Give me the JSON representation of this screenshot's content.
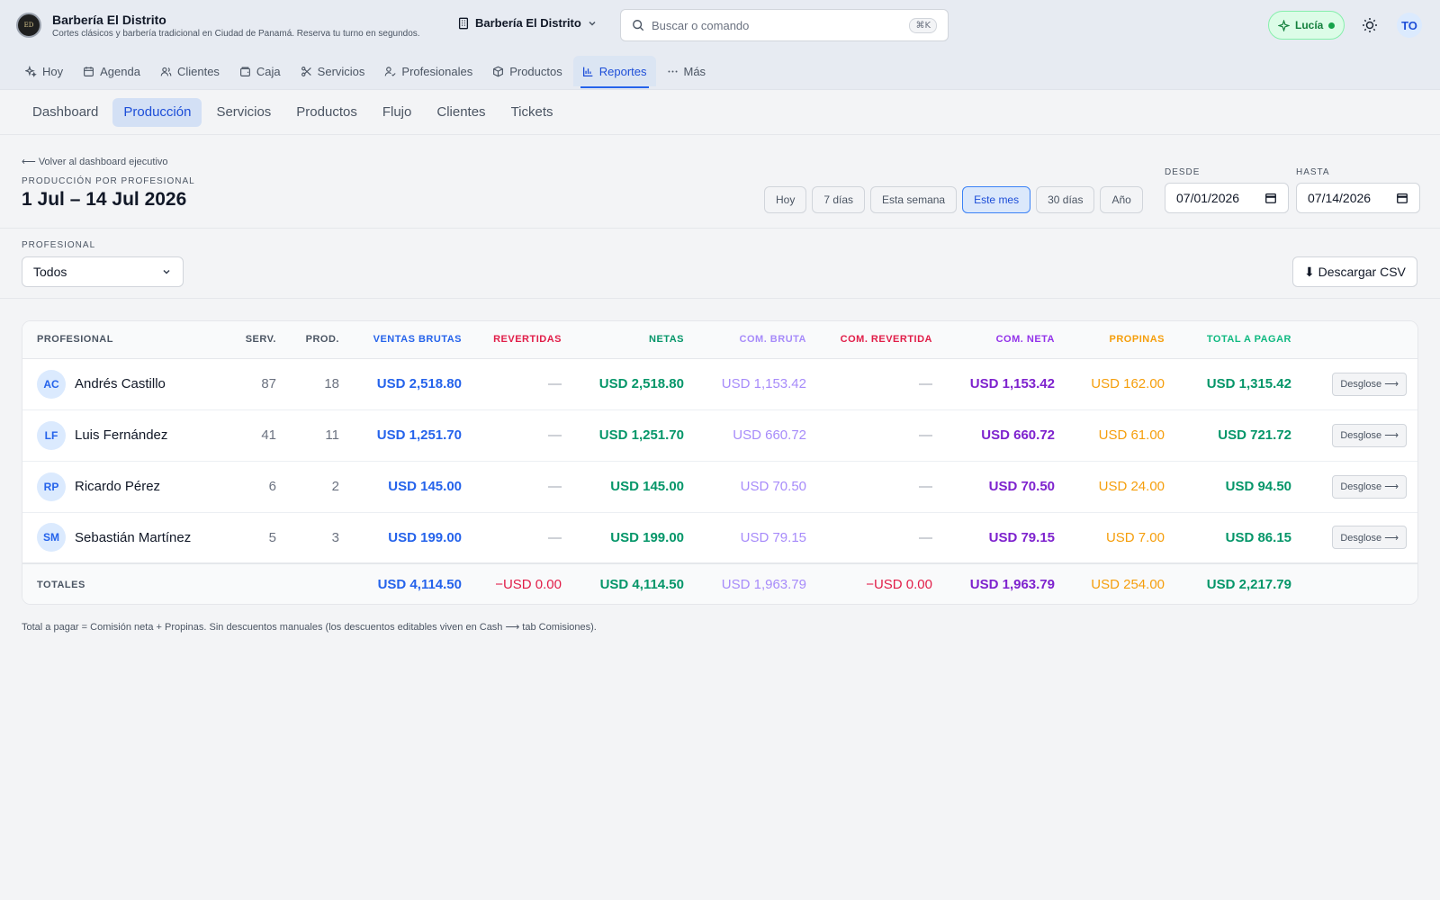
{
  "brand": {
    "name": "Barbería El Distrito",
    "subtitle": "Cortes clásicos y barbería tradicional en Ciudad de Panamá. Reserva tu turno en segundos.",
    "logo_text": "EL DISTRITO"
  },
  "branch": {
    "label": "Barbería El Distrito"
  },
  "search": {
    "placeholder": "Buscar o comando",
    "shortcut": "⌘K"
  },
  "assistant": {
    "label": "Lucía",
    "status_color": "#16a34a"
  },
  "user": {
    "initials": "TO"
  },
  "nav": {
    "items": [
      {
        "label": "Hoy",
        "icon": "sparkle-icon"
      },
      {
        "label": "Agenda",
        "icon": "calendar-icon"
      },
      {
        "label": "Clientes",
        "icon": "users-icon"
      },
      {
        "label": "Caja",
        "icon": "wallet-icon"
      },
      {
        "label": "Servicios",
        "icon": "scissors-icon"
      },
      {
        "label": "Profesionales",
        "icon": "user-check-icon"
      },
      {
        "label": "Productos",
        "icon": "box-icon"
      },
      {
        "label": "Reportes",
        "icon": "bar-chart-icon"
      },
      {
        "label": "Más",
        "icon": "more-icon"
      }
    ],
    "active": "Reportes"
  },
  "subtabs": {
    "items": [
      "Dashboard",
      "Producción",
      "Servicios",
      "Productos",
      "Flujo",
      "Clientes",
      "Tickets"
    ],
    "active": "Producción"
  },
  "report": {
    "back": "⟵ Volver al dashboard ejecutivo",
    "kicker": "PRODUCCIÓN POR PROFESIONAL",
    "title": "1 Jul – 14 Jul 2026",
    "ranges": [
      "Hoy",
      "7 días",
      "Esta semana",
      "Este mes",
      "30 días",
      "Año"
    ],
    "active_range": "Este mes",
    "from_label": "DESDE",
    "from_value": "07/01/2026",
    "to_label": "HASTA",
    "to_value": "07/14/2026"
  },
  "filter": {
    "label": "PROFESIONAL",
    "value": "Todos",
    "csv_label": "⬇ Descargar CSV"
  },
  "table": {
    "headers": {
      "profesional": "PROFESIONAL",
      "serv": "SERV.",
      "prod": "PROD.",
      "ventas": "VENTAS BRUTAS",
      "revertidas": "REVERTIDAS",
      "netas": "NETAS",
      "com_bruta": "COM. BRUTA",
      "com_revertida": "COM. REVERTIDA",
      "com_neta": "COM. NETA",
      "propinas": "PROPINAS",
      "total": "TOTAL A PAGAR"
    },
    "rows": [
      {
        "initials": "AC",
        "name": "Andrés Castillo",
        "serv": "87",
        "prod": "18",
        "ventas": "USD 2,518.80",
        "revertidas": "—",
        "netas": "USD 2,518.80",
        "com_bruta": "USD 1,153.42",
        "com_revertida": "—",
        "com_neta": "USD 1,153.42",
        "propinas": "USD 162.00",
        "total": "USD 1,315.42",
        "action": "Desglose ⟶"
      },
      {
        "initials": "LF",
        "name": "Luis Fernández",
        "serv": "41",
        "prod": "11",
        "ventas": "USD 1,251.70",
        "revertidas": "—",
        "netas": "USD 1,251.70",
        "com_bruta": "USD 660.72",
        "com_revertida": "—",
        "com_neta": "USD 660.72",
        "propinas": "USD 61.00",
        "total": "USD 721.72",
        "action": "Desglose ⟶"
      },
      {
        "initials": "RP",
        "name": "Ricardo Pérez",
        "serv": "6",
        "prod": "2",
        "ventas": "USD 145.00",
        "revertidas": "—",
        "netas": "USD 145.00",
        "com_bruta": "USD 70.50",
        "com_revertida": "—",
        "com_neta": "USD 70.50",
        "propinas": "USD 24.00",
        "total": "USD 94.50",
        "action": "Desglose ⟶"
      },
      {
        "initials": "SM",
        "name": "Sebastián Martínez",
        "serv": "5",
        "prod": "3",
        "ventas": "USD 199.00",
        "revertidas": "—",
        "netas": "USD 199.00",
        "com_bruta": "USD 79.15",
        "com_revertida": "—",
        "com_neta": "USD 79.15",
        "propinas": "USD 7.00",
        "total": "USD 86.15",
        "action": "Desglose ⟶"
      }
    ],
    "totals": {
      "label": "TOTALES",
      "ventas": "USD 4,114.50",
      "revertidas": "−USD 0.00",
      "netas": "USD 4,114.50",
      "com_bruta": "USD 1,963.79",
      "com_revertida": "−USD 0.00",
      "com_neta": "USD 1,963.79",
      "propinas": "USD 254.00",
      "total": "USD 2,217.79"
    }
  },
  "footnote": "Total a pagar = Comisión neta + Propinas. Sin descuentos manuales (los descuentos editables viven en Cash ⟶ tab Comisiones).",
  "colors": {
    "accent": "#2563eb",
    "green": "#059669",
    "red": "#e11d48",
    "purple": "#7e22ce",
    "orange": "#f59e0b"
  }
}
